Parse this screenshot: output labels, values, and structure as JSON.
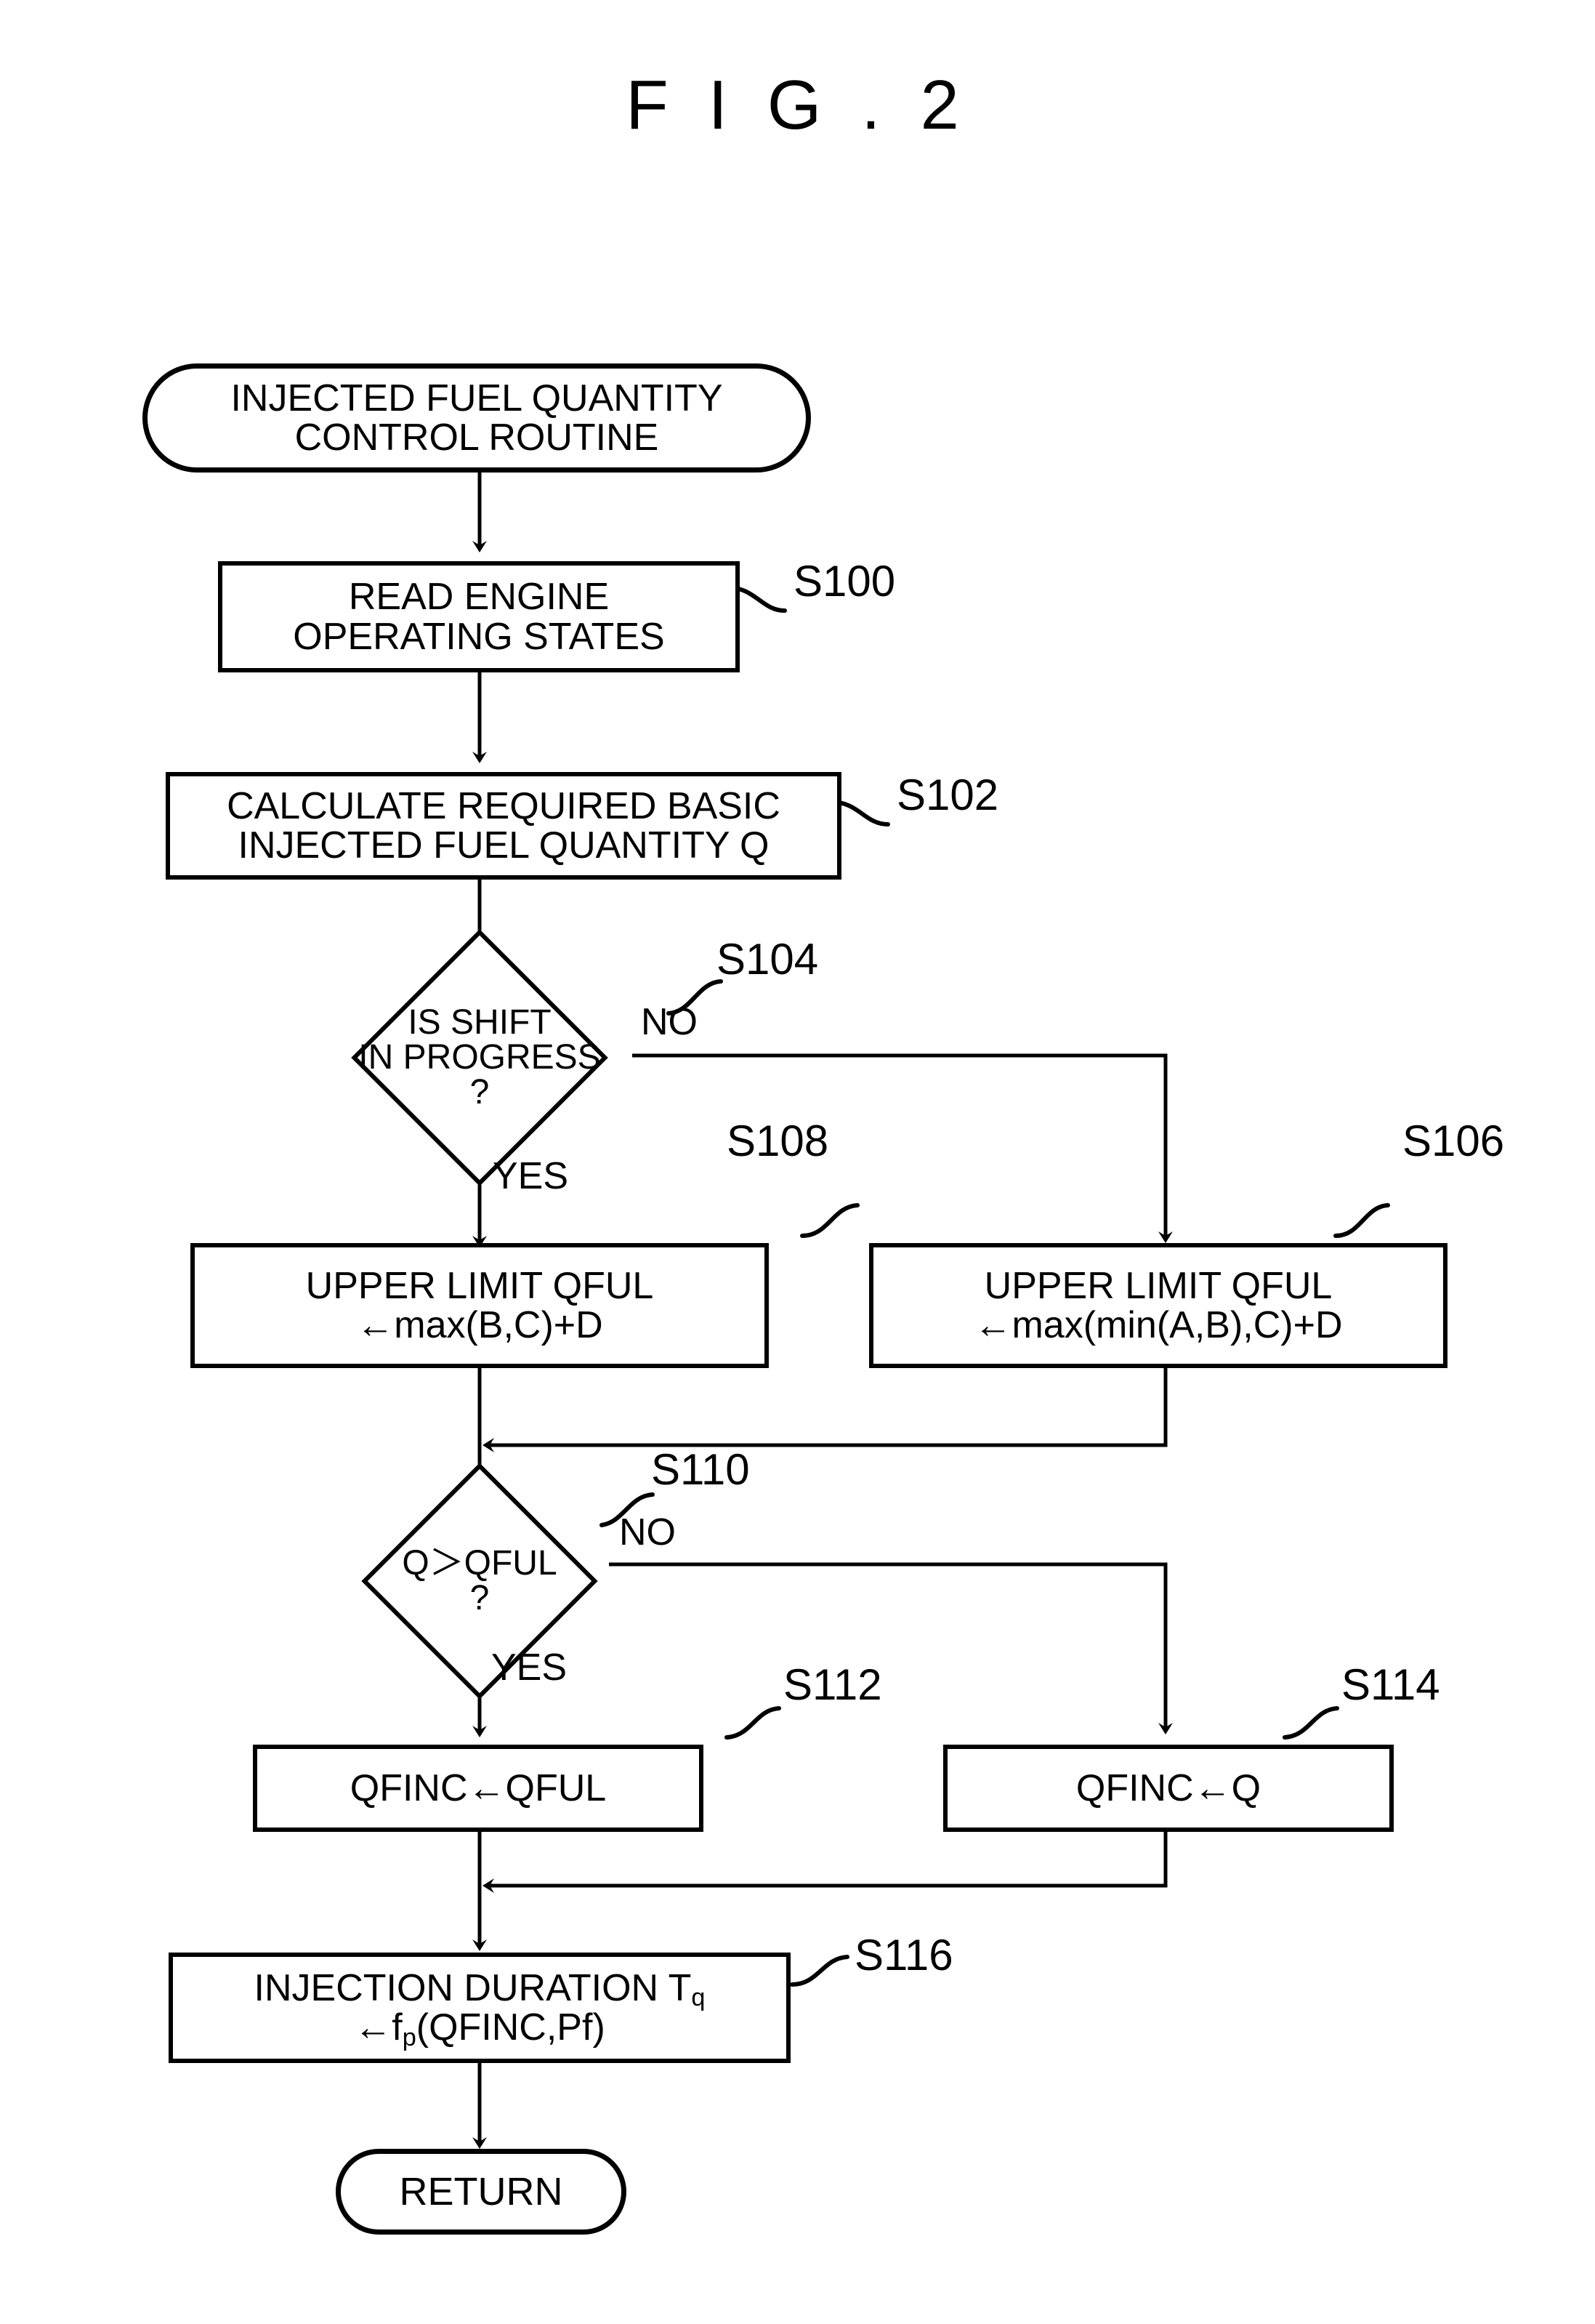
{
  "figure": {
    "title": "F I G . 2",
    "kind": "flowchart"
  },
  "nodes": {
    "start": {
      "type": "terminal",
      "line1": "INJECTED FUEL QUANTITY",
      "line2": "CONTROL ROUTINE"
    },
    "s100": {
      "type": "process",
      "step": "S100",
      "line1": "READ ENGINE",
      "line2": "OPERATING STATES"
    },
    "s102": {
      "type": "process",
      "step": "S102",
      "line1": "CALCULATE REQUIRED BASIC",
      "line2": "INJECTED FUEL QUANTITY Q"
    },
    "s104": {
      "type": "decision",
      "step": "S104",
      "line1": "IS SHIFT",
      "line2": "IN PROGRESS",
      "line3": "?",
      "yes_label": "YES",
      "no_label": "NO"
    },
    "s108": {
      "type": "process",
      "step": "S108",
      "line1": "UPPER LIMIT QFUL",
      "line2": "←max(B,C)+D"
    },
    "s106": {
      "type": "process",
      "step": "S106",
      "line1": "UPPER LIMIT QFUL",
      "line2": "←max(min(A,B),C)+D"
    },
    "s110": {
      "type": "decision",
      "step": "S110",
      "line1": "Q＞QFUL",
      "line2": "?",
      "yes_label": "YES",
      "no_label": "NO"
    },
    "s112": {
      "type": "process",
      "step": "S112",
      "line1": "QFINC←QFUL"
    },
    "s114": {
      "type": "process",
      "step": "S114",
      "line1": "QFINC←Q"
    },
    "s116": {
      "type": "process",
      "step": "S116",
      "line1_main": "INJECTION DURATION T",
      "line1_sub": "q",
      "line2_prefix": "←f",
      "line2_sub": "p",
      "line2_suffix": "(QFINC,Pf)"
    },
    "end": {
      "type": "terminal",
      "line1": "RETURN"
    }
  },
  "colors": {
    "ink": "#000000",
    "paper": "#ffffff"
  }
}
